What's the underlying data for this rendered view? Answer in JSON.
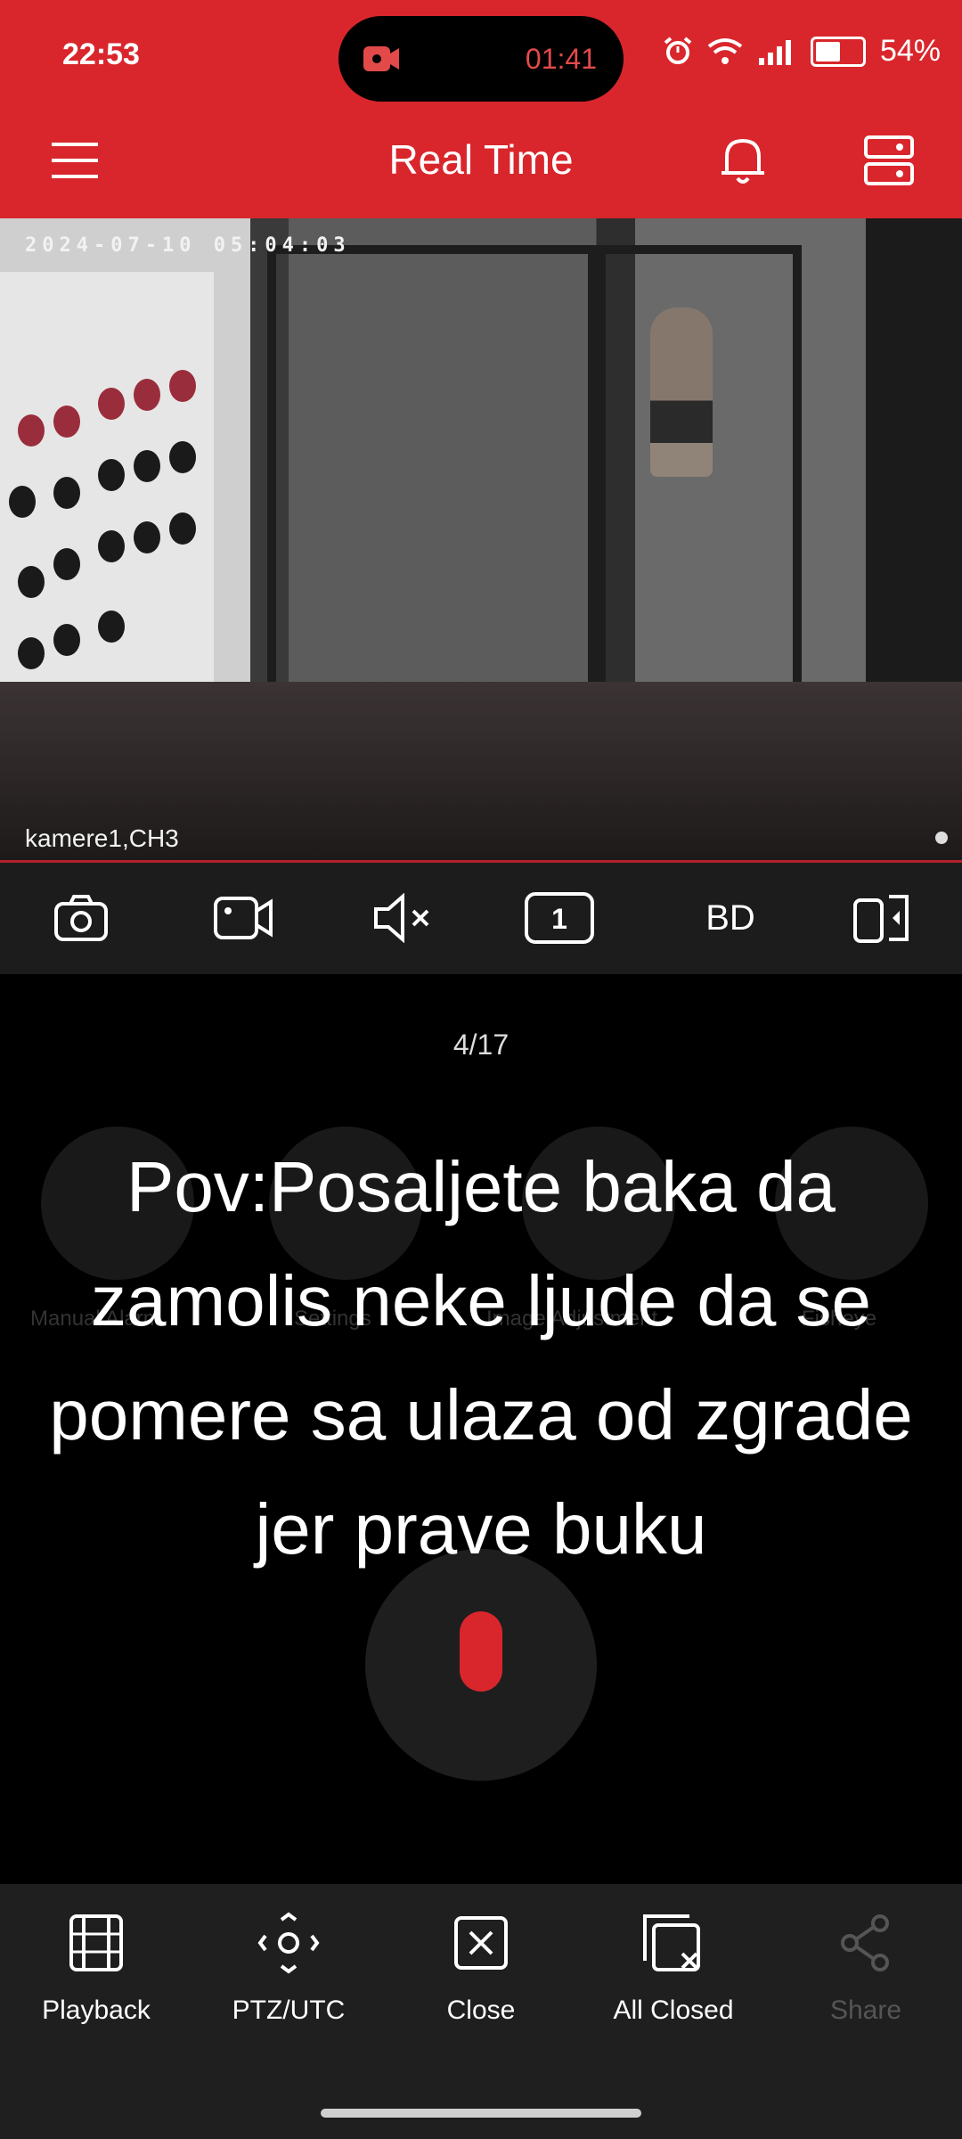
{
  "status_bar": {
    "time": "22:53",
    "recording_timer": "01:41",
    "battery": "54%",
    "battery_level": 0.54
  },
  "header": {
    "title": "Real Time"
  },
  "video": {
    "timestamp": "2024-07-10 05:04:03",
    "camera_label": "kamere1,CH3"
  },
  "toolbar": {
    "screen_count": "1",
    "quality": "BD"
  },
  "page_indicator": "4/17",
  "background_controls": [
    "Manual Alarm",
    "Settings",
    "Image Adjustment",
    "Fisheye"
  ],
  "caption": "Pov:Posaljete baka da zamolis neke ljude da se pomere sa ulaza od zgrade jer prave buku",
  "bottom_nav": [
    {
      "label": "Playback",
      "icon": "playback-icon",
      "enabled": true
    },
    {
      "label": "PTZ/UTC",
      "icon": "ptz-icon",
      "enabled": true
    },
    {
      "label": "Close",
      "icon": "close-icon",
      "enabled": true
    },
    {
      "label": "All Closed",
      "icon": "all-closed-icon",
      "enabled": true
    },
    {
      "label": "Share",
      "icon": "share-icon",
      "enabled": false
    }
  ],
  "colors": {
    "brand_red": "#d9262c",
    "toolbar_bg": "#1c1c1c",
    "bottom_bg": "#1f1f1f"
  }
}
